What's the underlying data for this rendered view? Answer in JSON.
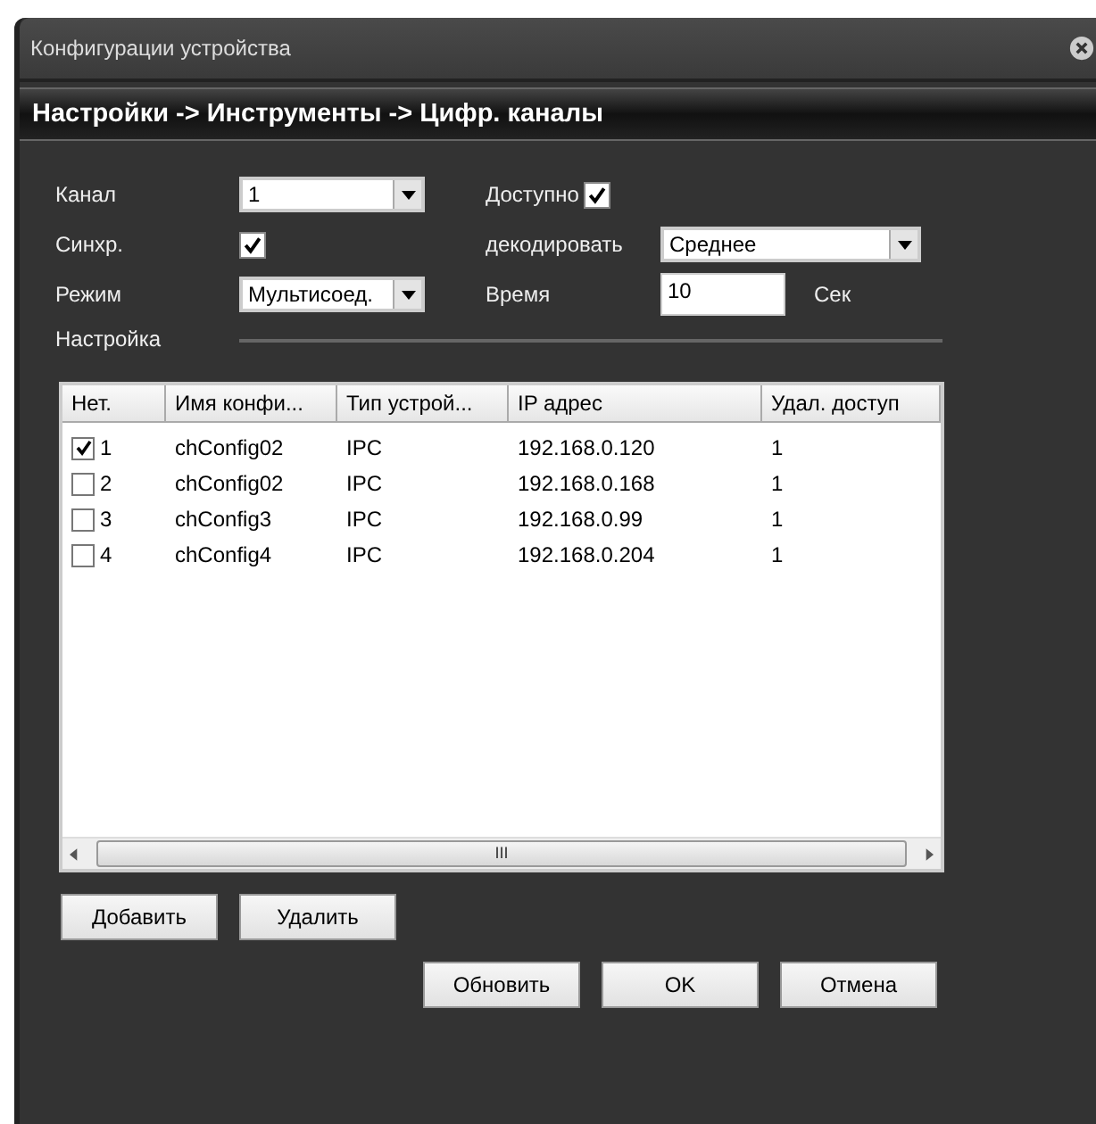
{
  "window": {
    "title": "Конфигурации устройства"
  },
  "breadcrumb": "Настройки -> Инструменты -> Цифр. каналы",
  "form": {
    "channel": {
      "label": "Канал",
      "value": "1"
    },
    "available": {
      "label": "Доступно",
      "checked": true
    },
    "sync": {
      "label": "Синхр.",
      "checked": true
    },
    "decode": {
      "label": "декодировать",
      "value": "Среднее"
    },
    "mode": {
      "label": "Режим",
      "value": "Мультисоед."
    },
    "time": {
      "label": "Время",
      "value": "10",
      "unit": "Сек"
    },
    "section": "Настройка"
  },
  "table": {
    "columns": [
      "Нет.",
      "Имя конфи...",
      "Тип устрой...",
      "IP адрес",
      "Удал. доступ"
    ],
    "rows": [
      {
        "checked": true,
        "cells": [
          "1",
          "chConfig02",
          "IPC",
          "192.168.0.120",
          "1"
        ]
      },
      {
        "checked": false,
        "cells": [
          "2",
          "chConfig02",
          "IPC",
          "192.168.0.168",
          "1"
        ]
      },
      {
        "checked": false,
        "cells": [
          "3",
          "chConfig3",
          "IPC",
          "192.168.0.99",
          "1"
        ]
      },
      {
        "checked": false,
        "cells": [
          "4",
          "chConfig4",
          "IPC",
          "192.168.0.204",
          "1"
        ]
      }
    ],
    "scroll_grip": "III"
  },
  "buttons_row": [
    "Добавить",
    "Удалить"
  ],
  "buttons": [
    "Обновить",
    "OK",
    "Отмена"
  ]
}
